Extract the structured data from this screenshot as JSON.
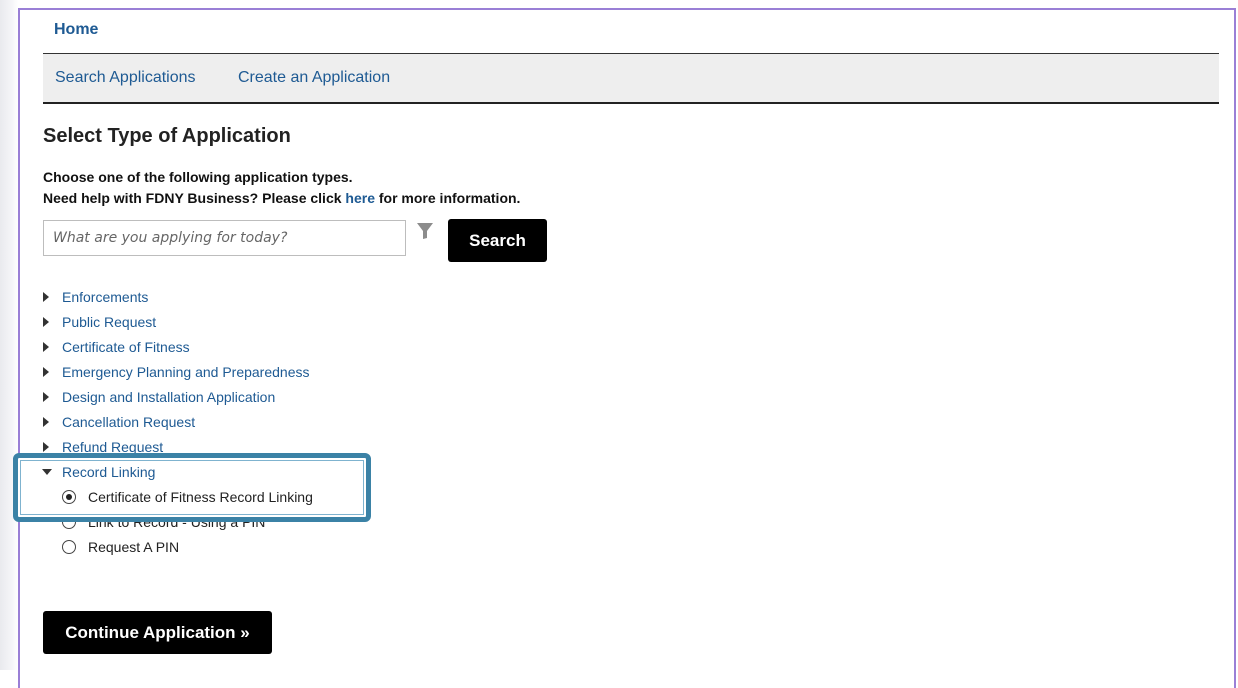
{
  "header": {
    "home_label": "Home"
  },
  "nav": {
    "items": [
      {
        "label": "Search Applications"
      },
      {
        "label": "Create an Application"
      }
    ]
  },
  "page": {
    "title": "Select Type of Application",
    "instruction_line1": "Choose one of the following application types.",
    "help_prefix": "Need help with FDNY Business? Please click ",
    "help_link": "here",
    "help_suffix": " for more information."
  },
  "search": {
    "placeholder": "What are you applying for today?",
    "value": "",
    "button_label": "Search"
  },
  "application_types": [
    {
      "label": "Enforcements",
      "expanded": false
    },
    {
      "label": "Public Request",
      "expanded": false
    },
    {
      "label": "Certificate of Fitness",
      "expanded": false
    },
    {
      "label": "Emergency Planning and Preparedness",
      "expanded": false
    },
    {
      "label": "Design and Installation Application",
      "expanded": false
    },
    {
      "label": "Cancellation Request",
      "expanded": false
    },
    {
      "label": "Refund Request",
      "expanded": false
    },
    {
      "label": "Record Linking",
      "expanded": true
    }
  ],
  "record_linking_options": [
    {
      "label": "Certificate of Fitness Record Linking",
      "selected": true
    },
    {
      "label": "Link to Record - Using a PIN",
      "selected": false
    },
    {
      "label": "Request A PIN",
      "selected": false
    }
  ],
  "actions": {
    "continue_label": "Continue Application »"
  },
  "colors": {
    "link": "#1e5a93",
    "frame": "#9a7fd6",
    "highlight": "#3b82a6",
    "button": "#000000"
  }
}
